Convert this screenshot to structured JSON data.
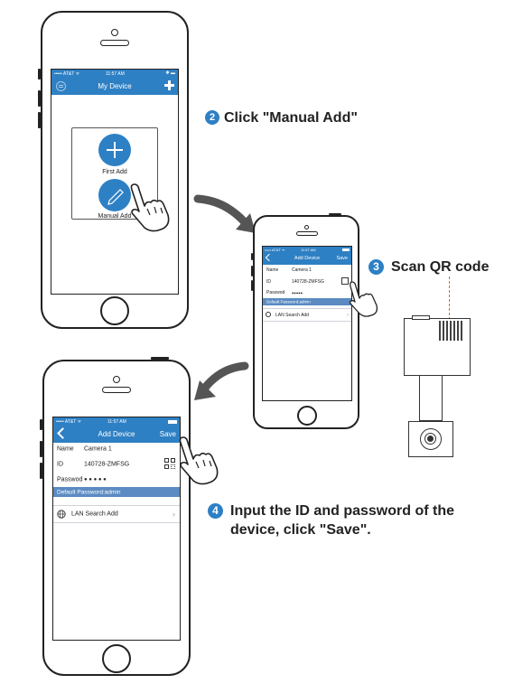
{
  "phone1": {
    "status_left": "••••• AT&T ᯤ",
    "status_time": "11:57 AM",
    "status_right": "✱ ▬",
    "title": "My Device",
    "first_add": "First Add",
    "manual_add": "Manual Add"
  },
  "phone2": {
    "status_left": "••••• AT&T ᯤ",
    "status_time": "11:57 AM",
    "title": "Add Device",
    "save": "Save",
    "name_label": "Name",
    "name_value": "Camera 1",
    "id_label": "ID",
    "id_value": "140728-ZMFSG",
    "password_label": "Passwod",
    "password_value": "●●●●●",
    "banner": "Default Password:admin",
    "lan": "LAN Search Add"
  },
  "phone3": {
    "status_left": "••••• AT&T ᯤ",
    "status_time": "11:57 AM",
    "title": "Add Device",
    "save": "Save",
    "name_label": "Name",
    "name_value": "Camera  1",
    "id_label": "ID",
    "id_value": "140728-ZMFSG",
    "password_label": "Passwod",
    "password_value": "● ● ● ● ●",
    "banner": "Default Password:admin",
    "lan": "LAN Search Add"
  },
  "steps": [
    {
      "num": "2",
      "text": "Click \"Manual Add\""
    },
    {
      "num": "3",
      "text": "Scan QR code"
    },
    {
      "num": "4",
      "text": "Input the ID and password of the device, click \"Save\"."
    }
  ],
  "colors": {
    "accent": "#2e80c4",
    "banner": "#5b8bc2",
    "arrow": "#555555"
  },
  "icons": [
    "plus-icon",
    "pencil-icon",
    "hand-pointer-icon",
    "back-chevron-icon",
    "qr-code-icon",
    "globe-icon",
    "chevron-right-icon",
    "menu-icon",
    "curved-arrow-icon"
  ]
}
